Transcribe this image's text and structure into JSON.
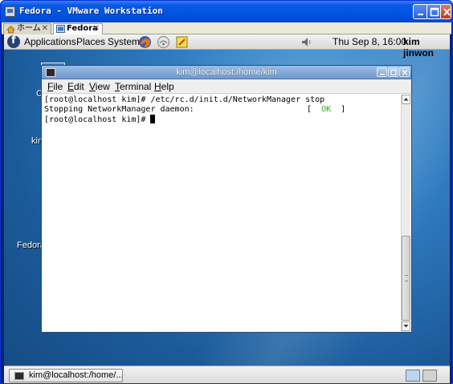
{
  "vmware": {
    "title": "Fedora - VMware Workstation",
    "tabs": [
      {
        "label": "ホーム",
        "active": false
      },
      {
        "label": "Fedora",
        "active": true
      }
    ]
  },
  "gnome_panel": {
    "menus": [
      "Applications",
      "Places",
      "System"
    ],
    "clock": "Thu Sep  8, 16:00",
    "user": "kim jinwon"
  },
  "desktop": {
    "labels": [
      "C",
      "kim",
      "Fedora"
    ]
  },
  "terminal": {
    "title": "kim@localhost:/home/kim",
    "menu": [
      "File",
      "Edit",
      "View",
      "Terminal",
      "Help"
    ],
    "lines": [
      "[root@localhost kim]# /etc/rc.d/init.d/NetworkManager stop",
      "Stopping NetworkManager daemon:"
    ],
    "status": {
      "open": "[",
      "text": "OK",
      "close": "]",
      "color": "#2aa820"
    },
    "prompt": "[root@localhost kim]# "
  },
  "taskbar": {
    "task_label": "kim@localhost:/home/..."
  },
  "colors": {
    "xp_titlebar": "#0054e3",
    "desktop_blue": "#2f7bbf",
    "terminal_titlebar": "#6f98cd"
  },
  "icons": [
    "app-icon",
    "home-icon",
    "fedora-tab-icon",
    "minimize-icon",
    "maximize-icon",
    "close-icon",
    "fedora-logo",
    "firefox-icon",
    "network-icon",
    "notes-icon",
    "speaker-icon",
    "terminal-icon"
  ]
}
